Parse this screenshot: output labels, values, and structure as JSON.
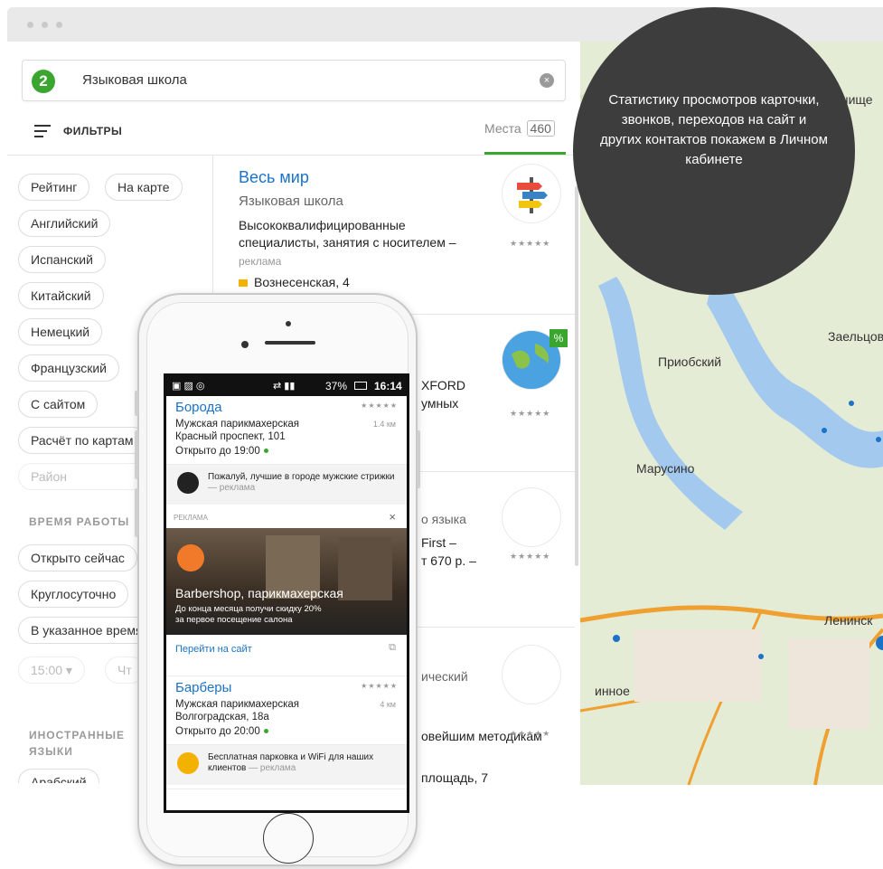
{
  "search": {
    "query": "Языковая школа"
  },
  "filters_bar": {
    "label": "ФИЛЬТРЫ",
    "places_tab": "Места",
    "places_count": "460"
  },
  "filter_chips": [
    "Рейтинг",
    "На карте",
    "Английский",
    "Испанский",
    "Китайский",
    "Немецкий",
    "Французский",
    "С сайтом",
    "Расчёт по картам",
    "Район"
  ],
  "hours_section": {
    "title": "ВРЕМЯ РАБОТЫ",
    "options": [
      "Открыто сейчас",
      "Круглосуточно",
      "В указанное время"
    ],
    "time_value": "15:00",
    "day_value": "Чт"
  },
  "languages_section": {
    "title": "ИНОСТРАННЫЕ ЯЗЫКИ",
    "first_option": "Арабский"
  },
  "results": [
    {
      "title": "Весь мир",
      "category": "Языковая школа",
      "description": "Высококвалифицированные специалисты, занятия с носителем –",
      "ad_label": "реклама",
      "address": "Вознесенская, 4",
      "rating": "★★★★★"
    },
    {
      "snippet_1": "XFORD",
      "snippet_2": "умных",
      "rating": "★★★★★",
      "badge": "%"
    },
    {
      "snippet_1": "о языка",
      "snippet_2": "First –",
      "snippet_3": "т 670 р. –",
      "rating": "★★★★★"
    },
    {
      "snippet_1": "ический",
      "snippet_2": "овейшим методикам",
      "snippet_3": "площадь, 7",
      "rating": "★★★★★"
    }
  ],
  "stat_bubble": {
    "text": "Статистику просмотров карточки, звонков, переходов на сайт и других контактов покажем в Личном кабинете"
  },
  "map_labels": [
    "Мочище",
    "Заельцов",
    "Приобский",
    "Марусино",
    "Ленинск",
    "инное"
  ],
  "phone": {
    "status_bar": {
      "battery": "37%",
      "time": "16:14"
    },
    "items": [
      {
        "title": "Борода",
        "type": "Мужская парикмахерская",
        "address": "Красный проспект, 101",
        "hours": "Открыто до 19:00",
        "distance": "1.4 км",
        "rating": "★★★★★",
        "promo": "Пожалуй, лучшие в городе мужские стрижки",
        "promo_ad": "— реклама"
      },
      {
        "title": "Барберы",
        "type": "Мужская парикмахерская",
        "address": "Волгоградская, 18а",
        "hours": "Открыто до 20:00",
        "distance": "4 км",
        "rating": "★★★★★",
        "promo": "Бесплатная парковка и WiFi для наших клиентов",
        "promo_ad": "— реклама"
      }
    ],
    "ad_block": {
      "label": "РЕКЛАМА",
      "close": "×",
      "title": "Barbershop, парикмахерская",
      "text_1": "До конца месяца получи скидку 20%",
      "text_2": "за первое посещение салона",
      "link": "Перейти на сайт"
    }
  },
  "colors": {
    "brand_green": "#3aa62f",
    "link_blue": "#1a73c8",
    "bubble": "#3e3d3d"
  }
}
